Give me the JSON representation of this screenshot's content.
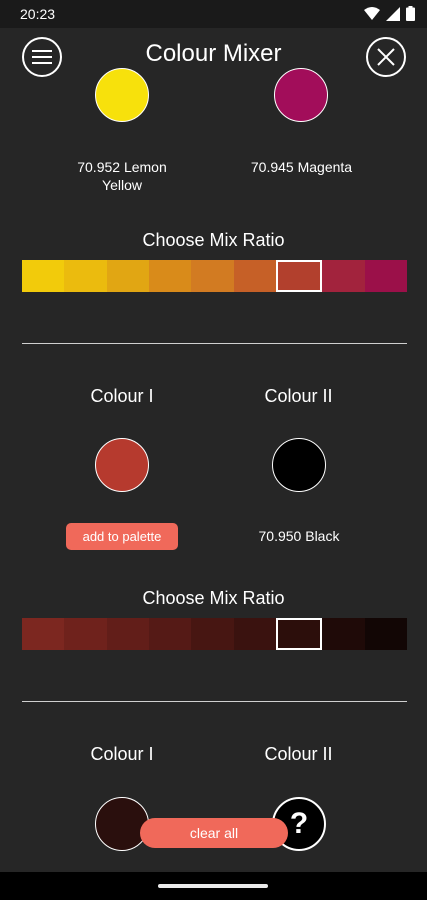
{
  "status": {
    "time": "20:23"
  },
  "appbar": {
    "title": "Colour Mixer",
    "menu_icon": "hamburger-menu-icon",
    "close_icon": "close-icon"
  },
  "mix1": {
    "colour_a": {
      "label": "70.952 Lemon\nYellow",
      "color": "#f7e10c"
    },
    "colour_b": {
      "label": "70.945 Magenta",
      "color": "#a20d5a"
    },
    "heading": "Choose Mix Ratio",
    "ratio_colors": [
      "#f2cb0b",
      "#ebbb0e",
      "#e1a613",
      "#d98b1a",
      "#d27b22",
      "#c66027",
      "#b2402d",
      "#a2233d",
      "#9b1049"
    ],
    "selected_index": 6
  },
  "mix2": {
    "colour_i_heading": "Colour I",
    "colour_ii_heading": "Colour II",
    "colour_i": {
      "color": "#b63a2e"
    },
    "colour_ii": {
      "label": "70.950 Black",
      "color": "#000000"
    },
    "add_button": "add to palette",
    "heading": "Choose Mix Ratio",
    "ratio_colors": [
      "#7c2720",
      "#6f221c",
      "#621e19",
      "#551a16",
      "#471612",
      "#3a120f",
      "#2c0e0b",
      "#1f0a08",
      "#120605"
    ],
    "selected_index": 6
  },
  "mix3": {
    "colour_i_heading": "Colour I",
    "colour_ii_heading": "Colour II",
    "colour_i": {
      "color": "#2a0f0d"
    },
    "colour_ii_placeholder": "?"
  },
  "clear_button": "clear all"
}
